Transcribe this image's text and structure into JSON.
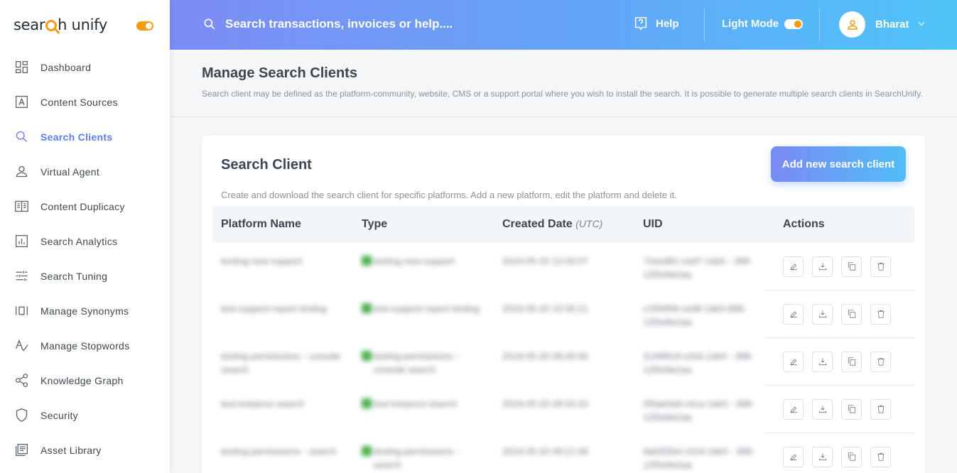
{
  "brand": {
    "name_prefix": "sear",
    "name_suffix": "h unify"
  },
  "sidebar": {
    "items": [
      {
        "label": "Dashboard",
        "icon": "dashboard-icon"
      },
      {
        "label": "Content Sources",
        "icon": "content-sources-icon"
      },
      {
        "label": "Search Clients",
        "icon": "search-icon",
        "active": true
      },
      {
        "label": "Virtual Agent",
        "icon": "user-icon"
      },
      {
        "label": "Content Duplicacy",
        "icon": "duplicacy-icon"
      },
      {
        "label": "Search Analytics",
        "icon": "analytics-icon"
      },
      {
        "label": "Search Tuning",
        "icon": "tuning-icon"
      },
      {
        "label": "Manage Synonyms",
        "icon": "synonyms-icon"
      },
      {
        "label": "Manage Stopwords",
        "icon": "stopwords-icon"
      },
      {
        "label": "Knowledge Graph",
        "icon": "share-icon"
      },
      {
        "label": "Security",
        "icon": "shield-icon"
      },
      {
        "label": "Asset Library",
        "icon": "library-icon"
      }
    ]
  },
  "header": {
    "search_placeholder": "Search transactions, invoices or help....",
    "help_label": "Help",
    "light_mode_label": "Light Mode",
    "user_name": "Bharat"
  },
  "page": {
    "title": "Manage Search Clients",
    "description": "Search client may be defined as the platform-community, website, CMS or a support portal where you wish to install the search. It is possible to generate multiple search clients in SearchUnify."
  },
  "card": {
    "title": "Search Client",
    "add_button": "Add new search client",
    "description": "Create and download the search client for specific platforms. Add a new platform, edit the platform and delete it."
  },
  "table": {
    "headers": {
      "platform": "Platform Name",
      "type": "Type",
      "created": "Created Date",
      "created_unit": "(UTC)",
      "uid": "UID",
      "actions": "Actions"
    },
    "rows": [
      {
        "name": "testing-new-support",
        "type": "testing-new-support",
        "date": "2019-05-20 12:00:07",
        "uid": "72eed81-ced7-1de5 - 398-12f2e9e2aa"
      },
      {
        "name": "test-support-report testing",
        "type": "test-support-report testing",
        "date": "2019-05-20 10:35:21",
        "uid": "c1f50f58-ced9-1de5-896-12f2e9e2aa"
      },
      {
        "name": "testing-permissions - console search",
        "type": "testing-permissions - console search",
        "date": "2019-05-20 09:45:56",
        "uid": "2c49f0c9-c0cb-1de5 - 398-12f2e9e2aa"
      },
      {
        "name": "test-instance-search",
        "type": "test-instance-search",
        "date": "2019-05-20 09:33:20",
        "uid": "0f3ae0a9-c0ca-1de5 - 398-12f2e9e2aa"
      },
      {
        "name": "testing-permissions - search",
        "type": "testing-permissions - search",
        "date": "2019-05-20 09:21:08",
        "uid": "9a62f2b4-c0c9-1de5 - 398-12f2e9e2aa"
      }
    ]
  }
}
